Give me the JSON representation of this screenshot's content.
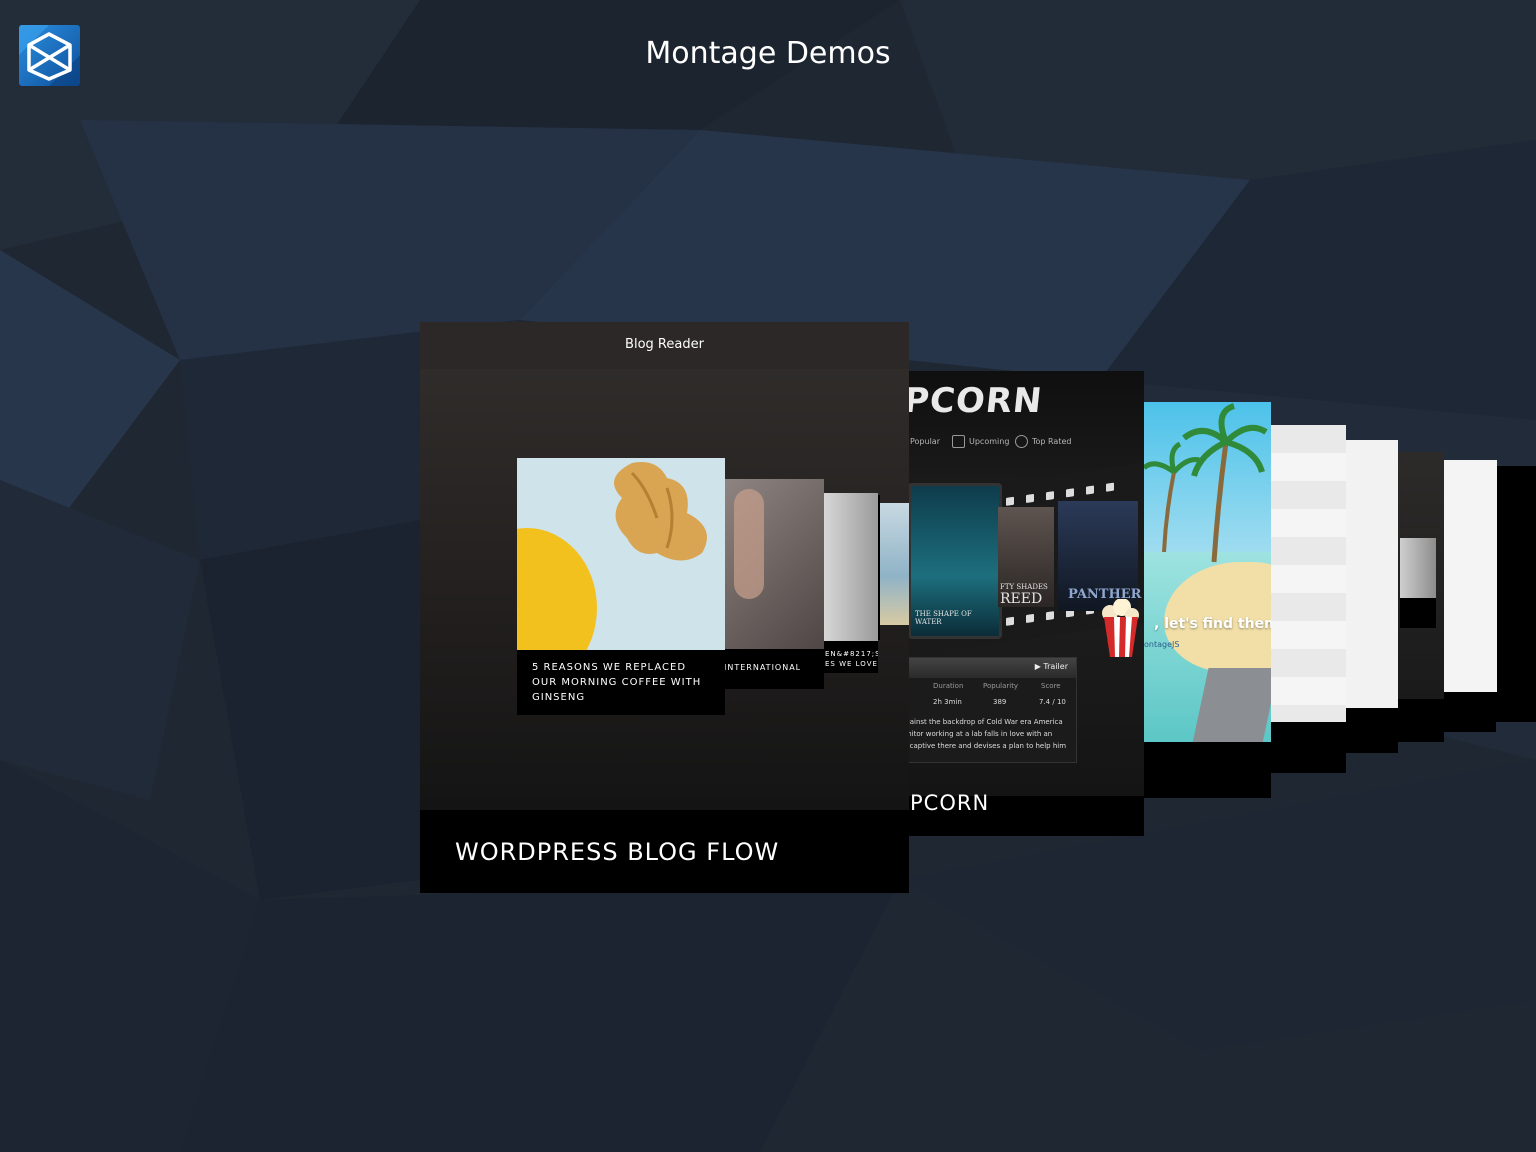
{
  "app": {
    "title": "Montage Demos"
  },
  "logo": {
    "icon": "montage-logo-icon",
    "color": "#1b73c2"
  },
  "background": {
    "color": "#1f2733"
  },
  "cards": {
    "main": {
      "header": "Blog Reader",
      "title": "WORDPRESS BLOG FLOW",
      "posts": [
        {
          "caption": "5 REASONS WE REPLACED OUR MORNING COFFEE WITH GINSENG"
        },
        {
          "caption": "INTERNATIONAL"
        },
        {
          "caption": "EN&#8217;S"
        },
        {
          "caption": "ES WE LOVE"
        }
      ]
    },
    "popcorn": {
      "logo": "PCORN",
      "title": "PCORN",
      "nav": [
        "Popular",
        "Upcoming",
        "Top Rated"
      ],
      "posters": [
        "THE SHAPE OF WATER",
        "FTY SHADES",
        "REED",
        "PANTHER"
      ],
      "trailer_label": "▶ Trailer",
      "columns": [
        "Duration",
        "Popularity",
        "Score"
      ],
      "values": [
        "2h 3min",
        "389",
        "7.4 / 10"
      ],
      "description": [
        "against the backdrop of Cold War era America",
        "janitor working at a lab falls in love with an",
        "ld captive there and devises a plan to help him"
      ]
    },
    "island": {
      "headline": ", let's find them!",
      "subtitle": "ontageJS"
    }
  }
}
